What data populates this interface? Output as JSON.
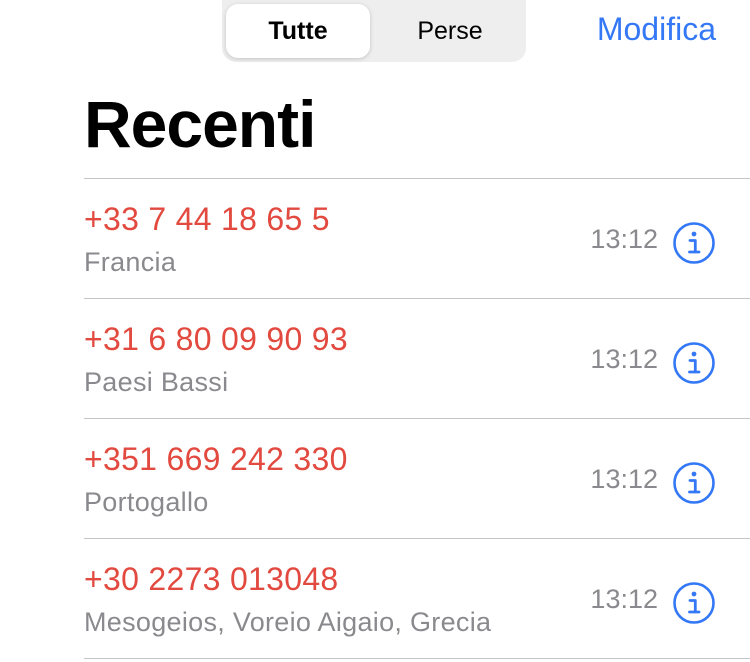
{
  "segmented_control": {
    "options": [
      "Tutte",
      "Perse"
    ],
    "selected": "Tutte"
  },
  "header": {
    "edit_label": "Modifica",
    "title": "Recenti"
  },
  "calls": [
    {
      "number": "+33 7 44 18 65 5",
      "location": "Francia",
      "time": "13:12",
      "missed": true
    },
    {
      "number": "+31 6 80 09 90 93",
      "location": "Paesi Bassi",
      "time": "13:12",
      "missed": true
    },
    {
      "number": "+351 669 242 330",
      "location": "Portogallo",
      "time": "13:12",
      "missed": true
    },
    {
      "number": "+30 2273 013048",
      "location": "Mesogeios, Voreio Aigaio, Grecia",
      "time": "13:12",
      "missed": true
    }
  ],
  "icons": {
    "info": "info-circle-icon"
  },
  "colors": {
    "accent": "#3478f6",
    "missed": "#e2493f",
    "secondary_text": "#8a8a8e",
    "separator": "#c6c6c8"
  }
}
